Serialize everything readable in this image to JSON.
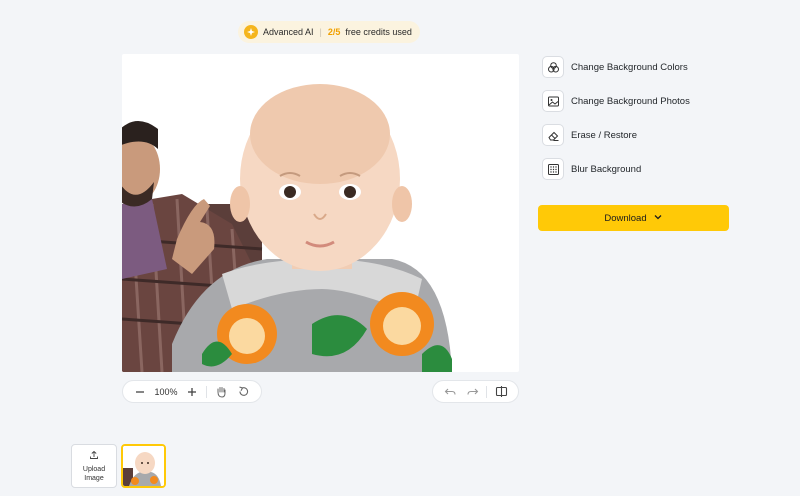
{
  "credits": {
    "label": "Advanced AI",
    "separator": "|",
    "used": "2/5",
    "suffix": "free credits used",
    "icon": "ai-sparkle-icon"
  },
  "canvas": {
    "subject": "baby-photo-with-background-removed"
  },
  "zoom": {
    "value": "100%",
    "icons": [
      "minus-icon",
      "plus-icon",
      "hand-icon",
      "reset-icon"
    ]
  },
  "history": {
    "icons": [
      "undo-icon",
      "redo-icon",
      "compare-icon"
    ]
  },
  "tools": [
    {
      "label": "Change Background Colors",
      "icon": "palette-icon"
    },
    {
      "label": "Change Background Photos",
      "icon": "image-icon"
    },
    {
      "label": "Erase / Restore",
      "icon": "eraser-icon"
    },
    {
      "label": "Blur Background",
      "icon": "blur-grid-icon"
    }
  ],
  "download": {
    "label": "Download",
    "icon": "chevron-down-icon"
  },
  "upload": {
    "label": "Upload Image",
    "icon": "upload-icon"
  },
  "colors": {
    "accent": "#ffc907",
    "credits_bg": "#fbf3df",
    "credits_used": "#f0a000",
    "page_bg": "#f3f5f8"
  }
}
